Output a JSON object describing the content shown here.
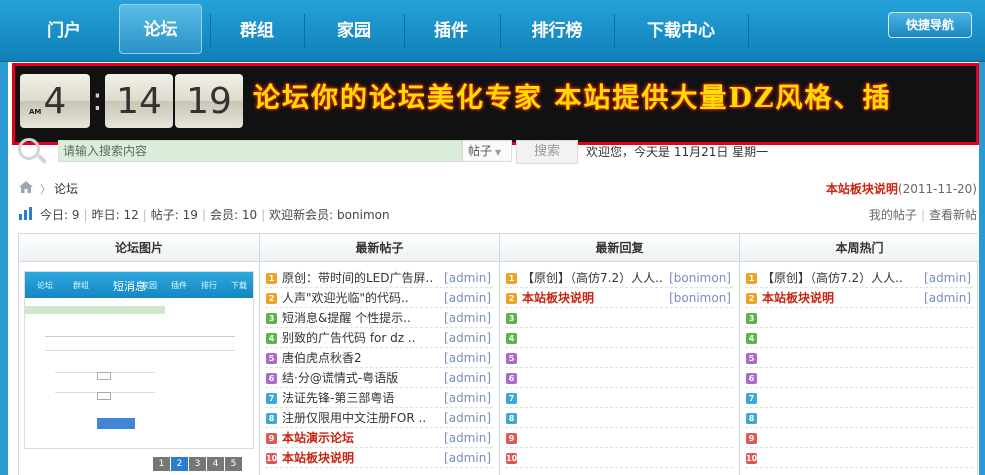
{
  "nav": {
    "items": [
      "门户",
      "论坛",
      "群组",
      "家园",
      "插件",
      "排行榜",
      "下载中心"
    ],
    "active": "论坛",
    "quick_nav": "快捷导航"
  },
  "banner": {
    "clock": {
      "ampm": "AM",
      "hour": "4",
      "minute": "14",
      "second": "19"
    },
    "marquee": "论坛你的论坛美化专家  本站提供大量DZ风格、插"
  },
  "search": {
    "placeholder": "请输入搜索内容",
    "scope": "帖子",
    "button": "搜索",
    "welcome": "欢迎您，今天是 11月21日 星期一"
  },
  "breadcrumb": {
    "current": "论坛"
  },
  "notice": {
    "link": "本站板块说明",
    "date": "(2011-11-20)"
  },
  "stats": {
    "today_label": "今日:",
    "today": "9",
    "yesterday_label": "昨日:",
    "yesterday": "12",
    "posts_label": "帖子:",
    "posts": "19",
    "members_label": "会员:",
    "members": "10",
    "newest_label": "欢迎新会员:",
    "newest": "bonimon"
  },
  "userlinks": {
    "my_posts": "我的帖子",
    "latest": "查看新帖"
  },
  "columns": {
    "images": {
      "title": "论坛图片",
      "slide_title": "短消息",
      "slide_nav": [
        "论坛",
        "群组",
        "家园",
        "插件",
        "排行",
        "下载"
      ],
      "pages": [
        "1",
        "2",
        "3",
        "4",
        "5"
      ]
    },
    "latest_posts": {
      "title": "最新帖子",
      "rows": [
        {
          "n": "1",
          "t": "原创：带时间的LED广告屏..",
          "a": "[admin]",
          "hot": false
        },
        {
          "n": "2",
          "t": "人声\"欢迎光临\"的代码..",
          "a": "[admin]",
          "hot": false
        },
        {
          "n": "3",
          "t": "短消息&提醒 个性提示..",
          "a": "[admin]",
          "hot": false
        },
        {
          "n": "4",
          "t": "别致的广告代码 for dz ..",
          "a": "[admin]",
          "hot": false
        },
        {
          "n": "5",
          "t": "唐伯虎点秋香2",
          "a": "[admin]",
          "hot": false
        },
        {
          "n": "6",
          "t": "结·分@谎情式-粤语版",
          "a": "[admin]",
          "hot": false
        },
        {
          "n": "7",
          "t": "法证先锋-第三部粤语",
          "a": "[admin]",
          "hot": false
        },
        {
          "n": "8",
          "t": "注册仅限用中文注册FOR ..",
          "a": "[admin]",
          "hot": false
        },
        {
          "n": "9",
          "t": "本站演示论坛",
          "a": "[admin]",
          "hot": true
        },
        {
          "n": "10",
          "t": "本站板块说明",
          "a": "[admin]",
          "hot": true
        }
      ]
    },
    "latest_replies": {
      "title": "最新回复",
      "rows": [
        {
          "n": "1",
          "t": "【原创】（高仿7.2）人人..",
          "a": "[bonimon]",
          "hot": false
        },
        {
          "n": "2",
          "t": "本站板块说明",
          "a": "[bonimon]",
          "hot": true
        },
        {
          "n": "3",
          "t": "",
          "a": "",
          "hot": false
        },
        {
          "n": "4",
          "t": "",
          "a": "",
          "hot": false
        },
        {
          "n": "5",
          "t": "",
          "a": "",
          "hot": false
        },
        {
          "n": "6",
          "t": "",
          "a": "",
          "hot": false
        },
        {
          "n": "7",
          "t": "",
          "a": "",
          "hot": false
        },
        {
          "n": "8",
          "t": "",
          "a": "",
          "hot": false
        },
        {
          "n": "9",
          "t": "",
          "a": "",
          "hot": false
        },
        {
          "n": "10",
          "t": "",
          "a": "",
          "hot": false
        }
      ]
    },
    "weekly_hot": {
      "title": "本周热门",
      "rows": [
        {
          "n": "1",
          "t": "【原创】（高仿7.2）人人..",
          "a": "[admin]",
          "hot": false
        },
        {
          "n": "2",
          "t": "本站板块说明",
          "a": "[admin]",
          "hot": true
        },
        {
          "n": "3",
          "t": "",
          "a": "",
          "hot": false
        },
        {
          "n": "4",
          "t": "",
          "a": "",
          "hot": false
        },
        {
          "n": "5",
          "t": "",
          "a": "",
          "hot": false
        },
        {
          "n": "6",
          "t": "",
          "a": "",
          "hot": false
        },
        {
          "n": "7",
          "t": "",
          "a": "",
          "hot": false
        },
        {
          "n": "8",
          "t": "",
          "a": "",
          "hot": false
        },
        {
          "n": "9",
          "t": "",
          "a": "",
          "hot": false
        },
        {
          "n": "10",
          "t": "",
          "a": "",
          "hot": false
        }
      ]
    }
  },
  "colors": {
    "nav_bg": "#1a93cc",
    "banner_border": "#e3001b",
    "marquee": "#ffde00",
    "hot_link": "#cc2211",
    "author": "#7a8fb8"
  }
}
